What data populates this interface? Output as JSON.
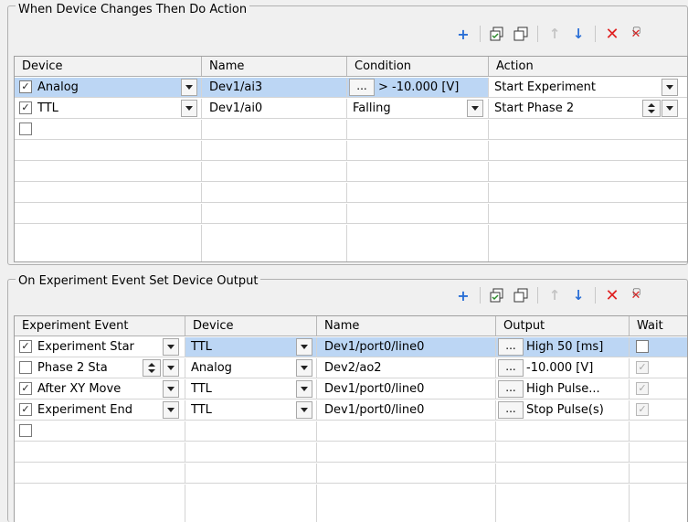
{
  "top": {
    "title": "When Device Changes Then Do Action",
    "headers": [
      "Device",
      "Name",
      "Condition",
      "Action"
    ],
    "rows": [
      {
        "checked": true,
        "device": "Analog",
        "name": "Dev1/ai3",
        "condition": "> -10.000 [V]",
        "action": "Start Experiment"
      },
      {
        "checked": true,
        "device": "TTL",
        "name": "Dev1/ai0",
        "condition": "Falling",
        "action": "Start Phase 2"
      }
    ]
  },
  "bottom": {
    "title": "On Experiment Event Set Device Output",
    "headers": [
      "Experiment Event",
      "Device",
      "Name",
      "Output",
      "Wait"
    ],
    "rows": [
      {
        "checked": true,
        "event": "Experiment Star",
        "device": "TTL",
        "name": "Dev1/port0/line0",
        "output": "High 50 [ms]",
        "wait": false
      },
      {
        "checked": false,
        "event": "Phase 2 Sta",
        "device": "Analog",
        "name": "Dev2/ao2",
        "output": "-10.000 [V]",
        "wait": true
      },
      {
        "checked": true,
        "event": "After XY Move",
        "device": "TTL",
        "name": "Dev1/port0/line0",
        "output": "High Pulse...",
        "wait": true
      },
      {
        "checked": true,
        "event": "Experiment End",
        "device": "TTL",
        "name": "Dev1/port0/line0",
        "output": "Stop Pulse(s)",
        "wait": true
      }
    ]
  },
  "ellipsis": "...",
  "icons": {
    "add": "plus-icon",
    "copy": "copy-icon",
    "paste": "paste-icon",
    "up": "arrow-up-icon",
    "down": "arrow-down-icon",
    "delete": "delete-icon",
    "delete_all": "delete-all-icon"
  },
  "colors": {
    "selection": "#bcd6f4",
    "delete": "#e02020",
    "add": "#2a6fd6"
  }
}
